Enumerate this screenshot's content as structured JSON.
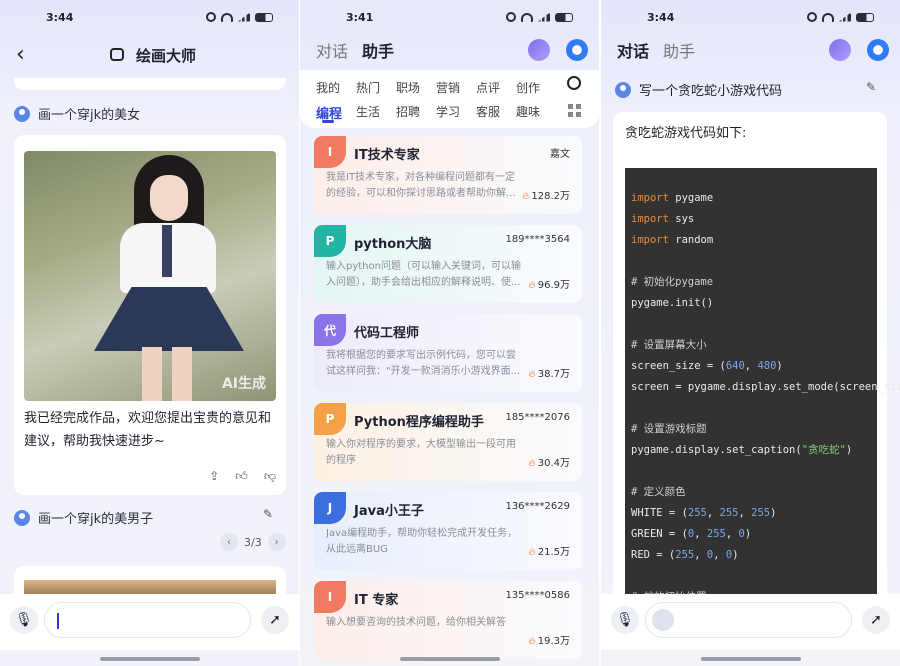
{
  "p1": {
    "time": "3:44",
    "title": "绘画大师",
    "prompt1": "画一个穿jk的美女",
    "image_label": "AI生成",
    "response": "我已经完成作品，欢迎您提出宝贵的意见和建议，帮助我快速进步~",
    "prompt2": "画一个穿jk的美男子",
    "pager": "3/3"
  },
  "p2": {
    "time": "3:41",
    "tabs": [
      "对话",
      "助手"
    ],
    "cat_row1": [
      "我的",
      "热门",
      "职场",
      "营销",
      "点评",
      "创作"
    ],
    "cat_row2": [
      "编程",
      "生活",
      "招聘",
      "学习",
      "客服",
      "趣味"
    ],
    "cards": [
      {
        "badge": "I",
        "name": "IT技术专家",
        "user": "嘉文",
        "desc": "我是IT技术专家，对各种编程问题都有一定的经验，可以和你探讨思路或者帮助你解...",
        "hot": "128.2万",
        "color": "#f07a62",
        "bg": "#fdeee9"
      },
      {
        "badge": "P",
        "name": "python大脑",
        "user": "189****3564",
        "desc": "输入python问题（可以输入关键词，可以输入问题），助手会给出相应的解释说明、使...",
        "hot": "96.9万",
        "color": "#22b5a3",
        "bg": "#e4f6f3"
      },
      {
        "badge": "代",
        "name": "代码工程师",
        "user": "",
        "desc": "我将根据您的要求写出示例代码，您可以尝试这样问我：\"开发一款消消乐小游戏界面...",
        "hot": "38.7万",
        "color": "#8b73ea",
        "bg": "#eeebfb"
      },
      {
        "badge": "P",
        "name": "Python程序编程助手",
        "user": "185****2076",
        "desc": "输入你对程序的要求，大模型输出一段可用的程序",
        "hot": "30.4万",
        "color": "#f5a147",
        "bg": "#fdf1e4"
      },
      {
        "badge": "J",
        "name": "Java小王子",
        "user": "136****2629",
        "desc": "Java编程助手，帮助你轻松完成开发任务，从此远离BUG",
        "hot": "21.5万",
        "color": "#3b6fe0",
        "bg": "#e7eefc"
      },
      {
        "badge": "I",
        "name": "IT 专家",
        "user": "135****0586",
        "desc": "输入想要咨询的技术问题，给你相关解答",
        "hot": "19.3万",
        "color": "#f07a62",
        "bg": "#fdeee9"
      }
    ]
  },
  "p3": {
    "time": "3:44",
    "tabs": [
      "对话",
      "助手"
    ],
    "prompt": "写一个贪吃蛇小游戏代码",
    "answer_head": "贪吃蛇游戏代码如下:"
  },
  "colors": {
    "accent": "#3146e0"
  }
}
